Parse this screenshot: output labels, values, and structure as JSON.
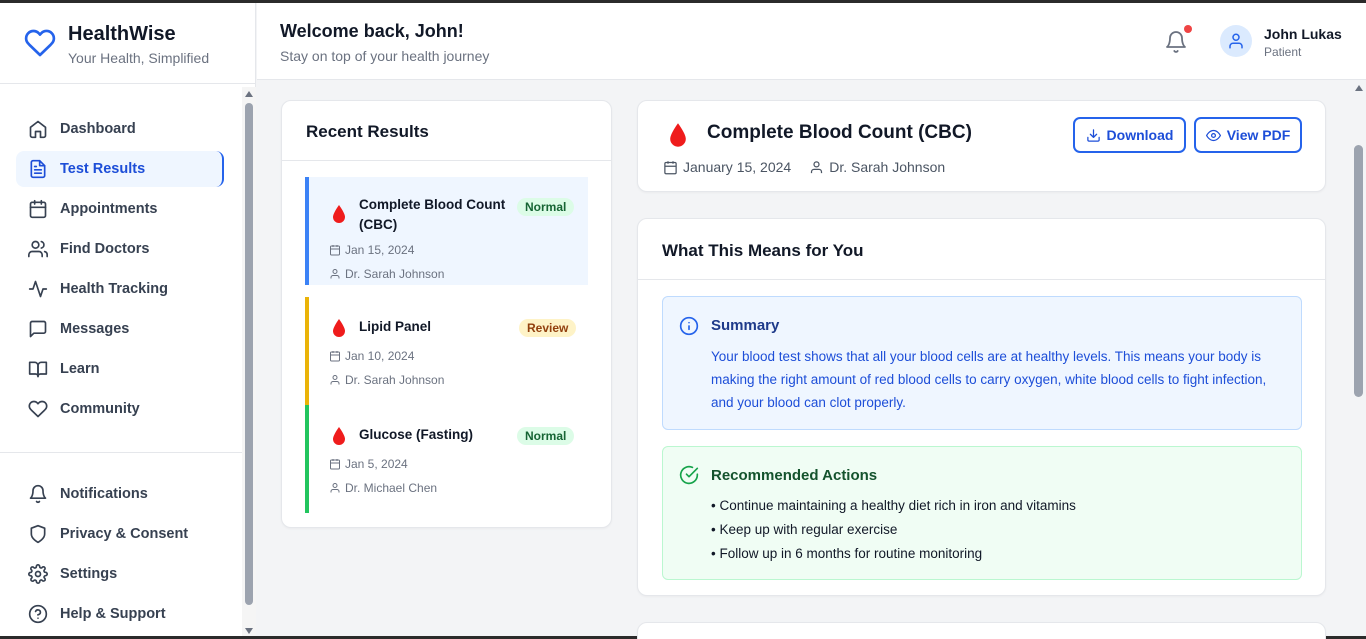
{
  "brand": {
    "name": "HealthWise",
    "tagline": "Your Health, Simplified",
    "color": "#2563eb"
  },
  "sidebar": {
    "items": [
      {
        "label": "Dashboard",
        "icon": "home-icon"
      },
      {
        "label": "Test Results",
        "icon": "document-icon",
        "active": true
      },
      {
        "label": "Appointments",
        "icon": "calendar-icon"
      },
      {
        "label": "Find Doctors",
        "icon": "users-icon"
      },
      {
        "label": "Health Tracking",
        "icon": "activity-icon"
      },
      {
        "label": "Messages",
        "icon": "message-icon"
      },
      {
        "label": "Learn",
        "icon": "book-icon"
      },
      {
        "label": "Community",
        "icon": "heart-icon"
      }
    ],
    "bottom_items": [
      {
        "label": "Notifications",
        "icon": "bell-icon"
      },
      {
        "label": "Privacy & Consent",
        "icon": "shield-icon"
      },
      {
        "label": "Settings",
        "icon": "gear-icon"
      },
      {
        "label": "Help & Support",
        "icon": "help-icon"
      }
    ]
  },
  "header": {
    "welcome": "Welcome back, John!",
    "subtitle": "Stay on top of your health journey",
    "user_name": "John Lukas",
    "user_role": "Patient"
  },
  "recent": {
    "title": "Recent Results",
    "items": [
      {
        "name": "Complete Blood Count (CBC)",
        "status": "Normal",
        "date": "Jan 15, 2024",
        "doctor": "Dr. Sarah Johnson",
        "accent": "#3b82f6"
      },
      {
        "name": "Lipid Panel",
        "status": "Review",
        "date": "Jan 10, 2024",
        "doctor": "Dr. Sarah Johnson",
        "accent": "#eab308"
      },
      {
        "name": "Glucose (Fasting)",
        "status": "Normal",
        "date": "Jan 5, 2024",
        "doctor": "Dr. Michael Chen",
        "accent": "#22c55e"
      }
    ]
  },
  "detail": {
    "title": "Complete Blood Count (CBC)",
    "date": "January 15, 2024",
    "doctor": "Dr. Sarah Johnson",
    "download_label": "Download",
    "viewpdf_label": "View PDF"
  },
  "means": {
    "title": "What This Means for You",
    "summary_title": "Summary",
    "summary_body": "Your blood test shows that all your blood cells are at healthy levels. This means your body is making the right amount of red blood cells to carry oxygen, white blood cells to fight infection, and your blood can clot properly.",
    "actions_title": "Recommended Actions",
    "actions": [
      "• Continue maintaining a healthy diet rich in iron and vitamins",
      "• Keep up with regular exercise",
      "• Follow up in 6 months for routine monitoring"
    ]
  }
}
